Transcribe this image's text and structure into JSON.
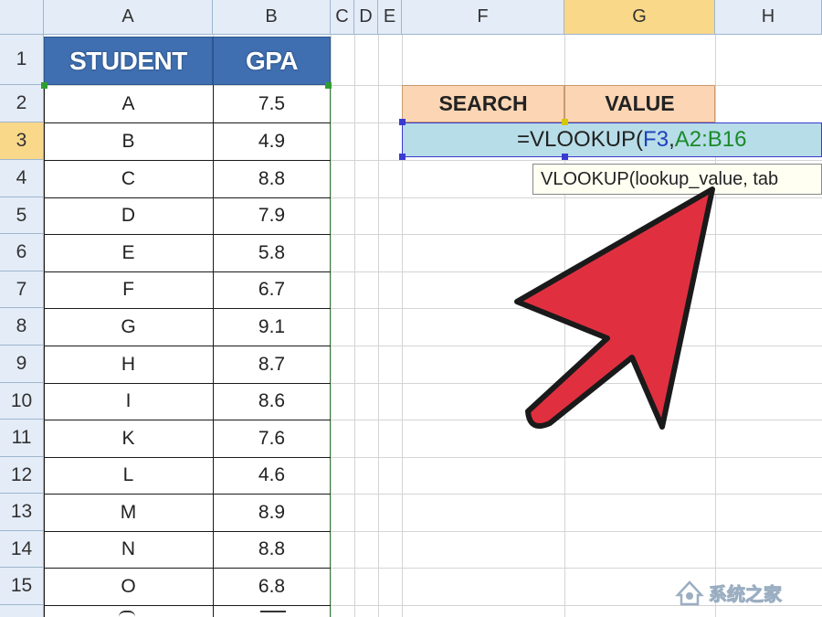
{
  "columns": [
    "A",
    "B",
    "C",
    "D",
    "E",
    "F",
    "G",
    "H"
  ],
  "rows": [
    "1",
    "2",
    "3",
    "4",
    "5",
    "6",
    "7",
    "8",
    "9",
    "10",
    "11",
    "12",
    "13",
    "14",
    "15"
  ],
  "table": {
    "header_student": "STUDENT",
    "header_gpa": "GPA",
    "students": [
      "A",
      "B",
      "C",
      "D",
      "E",
      "F",
      "G",
      "H",
      "I",
      "K",
      "L",
      "M",
      "N",
      "O"
    ],
    "gpas": [
      "7.5",
      "4.9",
      "8.8",
      "7.9",
      "5.8",
      "6.7",
      "9.1",
      "8.7",
      "8.6",
      "7.6",
      "4.6",
      "8.9",
      "8.8",
      "6.8"
    ]
  },
  "lookup": {
    "search_label": "SEARCH",
    "value_label": "VALUE"
  },
  "formula": {
    "prefix": "=VLOOKUP(",
    "ref1": "F3",
    "sep": ",",
    "ref2": "A2:B16"
  },
  "tooltip": {
    "text": "VLOOKUP(lookup_value, tab"
  },
  "watermark": "系统之家",
  "colors": {
    "header_blue": "#3f6fb0",
    "peach": "#fcd5b4",
    "formula_bg": "#b7dde8",
    "ref1_blue": "#1f3fbf",
    "ref2_green": "#1a8a2a",
    "arrow_red": "#e03040"
  }
}
